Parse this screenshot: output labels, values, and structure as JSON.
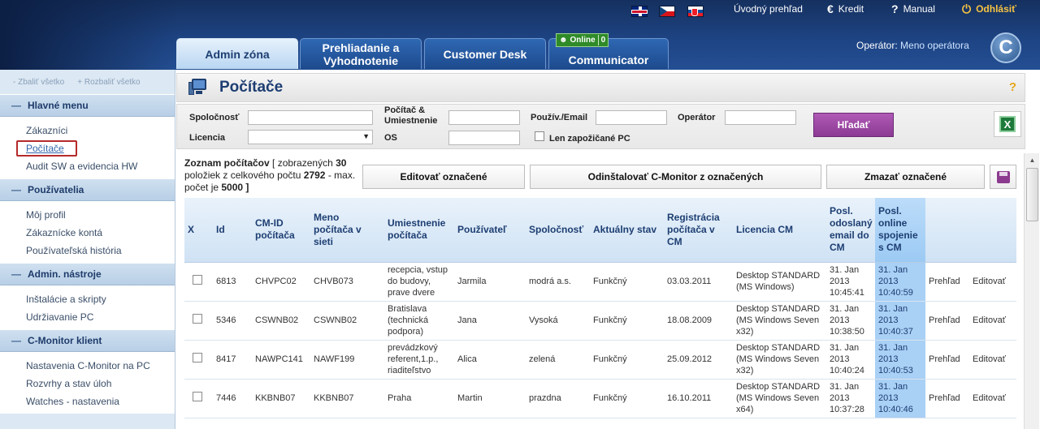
{
  "topbar": {
    "flags": [
      "flag-uk",
      "flag-cz",
      "flag-sk"
    ],
    "home": "Úvodný prehľad",
    "credit": "Kredit",
    "manual": "Manual",
    "logout": "Odhlásiť",
    "icons": {
      "credit": "euro-icon",
      "manual": "question-icon",
      "logout": "power-icon"
    }
  },
  "tabs": [
    {
      "label": "Admin zóna"
    },
    {
      "label": "Prehliadanie a Vyhodnotenie"
    },
    {
      "label": "Customer Desk"
    },
    {
      "label": "Communicator"
    }
  ],
  "online": {
    "label": "Online",
    "count": "0"
  },
  "operator": {
    "label": "Operátor:",
    "name": "Meno operátora"
  },
  "logo": {
    "letter": "C"
  },
  "sidebar": {
    "collapse_all": "Zbaliť všetko",
    "expand_all": "Rozbaliť všetko",
    "sections": [
      {
        "title": "Hlavné menu",
        "items": [
          "Zákazníci",
          "Počítače",
          "Audit SW a evidencia HW"
        ]
      },
      {
        "title": "Používatelia",
        "items": [
          "Môj profil",
          "Zákaznícke kontá",
          "Používateľská história"
        ]
      },
      {
        "title": "Admin. nástroje",
        "items": [
          "Inštalácie a skripty",
          "Udržiavanie PC"
        ]
      },
      {
        "title": "C-Monitor klient",
        "items": [
          "Nastavenia C-Monitor na PC",
          "Rozvrhy a stav úloh",
          "Watches - nastavenia"
        ]
      }
    ],
    "active_item": "Počítače"
  },
  "page": {
    "title": "Počítače",
    "help": "?"
  },
  "filter": {
    "company": "Spoločnosť",
    "computer": "Počítač & Umiestnenie",
    "user": "Použív./Email",
    "operator": "Operátor",
    "license": "Licencia",
    "os": "OS",
    "loaned": "Len zapožičané PC",
    "search": "Hľadať",
    "license_selected": ""
  },
  "list": {
    "title": "Zoznam počítačov",
    "shown_prefix": "[ zobrazených",
    "shown": "30",
    "total_prefix": "položiek z celkového počtu",
    "total": "2792",
    "max_prefix": "- max. počet je",
    "max": "5000",
    "suffix": "]"
  },
  "actions": {
    "edit": "Editovať označené",
    "uninstall": "Odinštalovať C-Monitor z označených",
    "delete": "Zmazať označené"
  },
  "table": {
    "headers": [
      "X",
      "Id",
      "CM-ID počítača",
      "Meno počítača v sieti",
      "Umiestnenie počítača",
      "Používateľ",
      "Spoločnosť",
      "Aktuálny stav",
      "Registrácia počítača v CM",
      "Licencia CM",
      "Posl. odoslaný email do CM",
      "Posl. online spojenie s CM",
      "",
      ""
    ],
    "rows": [
      {
        "id": "6813",
        "cmid": "CHVPC02",
        "name": "CHVB073",
        "location": "recepcia, vstup do budovy, prave dvere",
        "user": "Jarmila",
        "company": "modrá a.s.",
        "state": "Funkčný",
        "registered": "03.03.2011",
        "license": "Desktop STANDARD (MS Windows)",
        "email": "31. Jan 2013 10:45:41",
        "online": "31. Jan 2013 10:40:59",
        "overview": "Prehľad",
        "edit": "Editovať"
      },
      {
        "id": "5346",
        "cmid": "CSWNB02",
        "name": "CSWNB02",
        "location": "Bratislava (technická podpora)",
        "user": "Jana",
        "company": "Vysoká",
        "state": "Funkčný",
        "registered": "18.08.2009",
        "license": "Desktop STANDARD (MS Windows Seven x32)",
        "email": "31. Jan 2013 10:38:50",
        "online": "31. Jan 2013 10:40:37",
        "overview": "Prehľad",
        "edit": "Editovať"
      },
      {
        "id": "8417",
        "cmid": "NAWPC141",
        "name": "NAWF199",
        "location": "prevádzkový referent,1.p., riaditeľstvo",
        "user": "Alica",
        "company": "zelená",
        "state": "Funkčný",
        "registered": "25.09.2012",
        "license": "Desktop STANDARD (MS Windows Seven x32)",
        "email": "31. Jan 2013 10:40:24",
        "online": "31. Jan 2013 10:40:53",
        "overview": "Prehľad",
        "edit": "Editovať"
      },
      {
        "id": "7446",
        "cmid": "KKBNB07",
        "name": "KKBNB07",
        "location": "Praha",
        "user": "Martin",
        "company": "prazdna",
        "state": "Funkčný",
        "registered": "16.10.2011",
        "license": "Desktop STANDARD (MS Windows Seven x64)",
        "email": "31. Jan 2013 10:37:28",
        "online": "31. Jan 2013 10:40:46",
        "overview": "Prehľad",
        "edit": "Editovať"
      }
    ]
  }
}
